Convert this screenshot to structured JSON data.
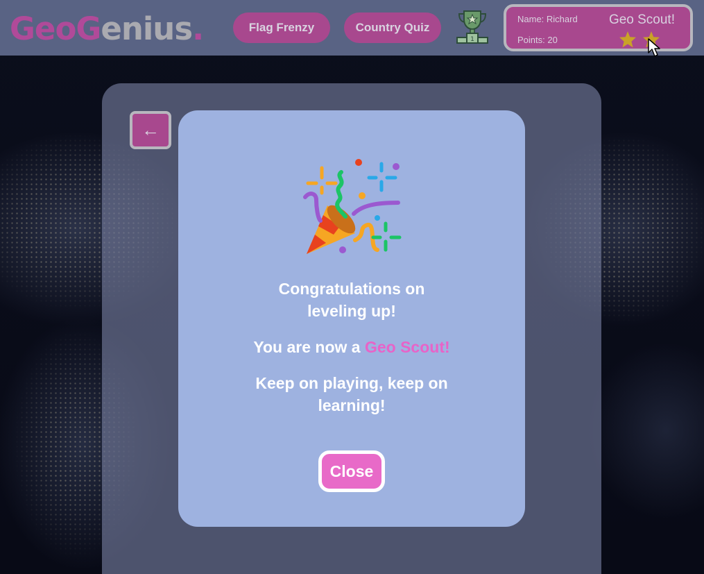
{
  "header": {
    "logo_part1": "Geo",
    "logo_part2": "Genius",
    "logo_dot": ".",
    "nav": [
      {
        "label": "Flag Frenzy"
      },
      {
        "label": "Country Quiz"
      }
    ],
    "trophy_icon": "trophy-icon"
  },
  "profile": {
    "name_label": "Name: Richard",
    "points_label": "Points: 20",
    "rank": "Geo Scout!",
    "stars": 2,
    "star_color": "#c9a227"
  },
  "panel": {
    "back_label": "←"
  },
  "modal": {
    "icon": "party-popper-icon",
    "line1": "Congratulations on",
    "line2": "leveling up!",
    "rank_prefix": "You are now a ",
    "rank_name": "Geo Scout!",
    "encourage1": "Keep on playing, keep on",
    "encourage2": "learning!",
    "close_label": "Close"
  },
  "colors": {
    "brand_pink": "#a8488e",
    "highlight_pink": "#e863c8",
    "modal_bg": "#9eb2e0",
    "header_bg": "#596384"
  }
}
